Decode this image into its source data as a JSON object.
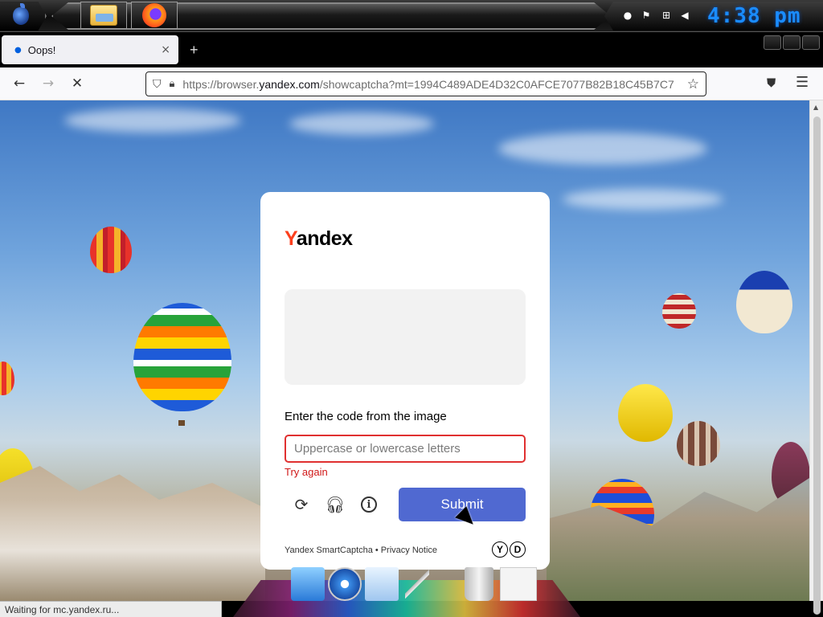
{
  "taskbar": {
    "clock": "4:38 pm",
    "apps": [
      "file-explorer",
      "firefox"
    ]
  },
  "browser": {
    "tab_title": "Oops!",
    "tab_close": "×",
    "new_tab": "+",
    "url_prefix": "https://browser.",
    "url_host": "yandex.com",
    "url_path": "/showcaptcha?mt=1994C489ADE4D32C0AFCE7077B82B18C45B7C7",
    "status_text": "Waiting for mc.yandex.ru..."
  },
  "captcha": {
    "logo_first": "Y",
    "logo_rest": "andex",
    "prompt": "Enter the code from the image",
    "input_placeholder": "Uppercase or lowercase letters",
    "error": "Try again",
    "submit_label": "Submit",
    "footer_product": "Yandex SmartCaptcha",
    "footer_separator": "•",
    "footer_privacy": "Privacy Notice",
    "badge_y": "Y",
    "badge_d": "D"
  },
  "colors": {
    "yandex_red": "#fc3f1d",
    "submit_blue": "#5069d1",
    "error_red": "#d01818",
    "clock_blue": "#1a8cff"
  },
  "icons": {
    "back": "left-arrow-icon",
    "forward": "right-arrow-icon",
    "stop": "close-x-icon",
    "refresh": "refresh-icon",
    "audio": "headphones-icon",
    "info": "info-icon"
  }
}
